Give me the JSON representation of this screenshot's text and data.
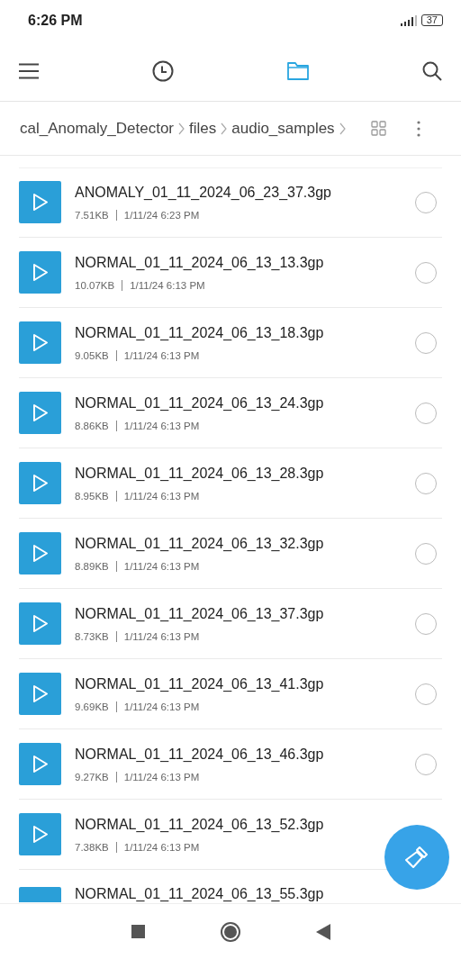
{
  "status_bar": {
    "time": "6:26 PM",
    "battery": "37"
  },
  "toolbar": {
    "tabs": [
      {
        "kind": "recent",
        "selected": false
      },
      {
        "kind": "folder",
        "selected": true
      }
    ]
  },
  "breadcrumb": [
    "cal_Anomaly_Detector",
    "files",
    "audio_samples"
  ],
  "files": [
    {
      "name": "ANOMALY_01_11_2024_06_23_37.3gp",
      "size": "7.51KB",
      "date": "1/11/24 6:23 PM",
      "selected": false
    },
    {
      "name": "NORMAL_01_11_2024_06_13_13.3gp",
      "size": "10.07KB",
      "date": "1/11/24 6:13 PM",
      "selected": false
    },
    {
      "name": "NORMAL_01_11_2024_06_13_18.3gp",
      "size": "9.05KB",
      "date": "1/11/24 6:13 PM",
      "selected": false
    },
    {
      "name": "NORMAL_01_11_2024_06_13_24.3gp",
      "size": "8.86KB",
      "date": "1/11/24 6:13 PM",
      "selected": false
    },
    {
      "name": "NORMAL_01_11_2024_06_13_28.3gp",
      "size": "8.95KB",
      "date": "1/11/24 6:13 PM",
      "selected": false
    },
    {
      "name": "NORMAL_01_11_2024_06_13_32.3gp",
      "size": "8.89KB",
      "date": "1/11/24 6:13 PM",
      "selected": false
    },
    {
      "name": "NORMAL_01_11_2024_06_13_37.3gp",
      "size": "8.73KB",
      "date": "1/11/24 6:13 PM",
      "selected": false
    },
    {
      "name": "NORMAL_01_11_2024_06_13_41.3gp",
      "size": "9.69KB",
      "date": "1/11/24 6:13 PM",
      "selected": false
    },
    {
      "name": "NORMAL_01_11_2024_06_13_46.3gp",
      "size": "9.27KB",
      "date": "1/11/24 6:13 PM",
      "selected": false
    },
    {
      "name": "NORMAL_01_11_2024_06_13_52.3gp",
      "size": "7.38KB",
      "date": "1/11/24 6:13 PM"
    },
    {
      "name": "NORMAL_01_11_2024_06_13_55.3gp"
    }
  ]
}
